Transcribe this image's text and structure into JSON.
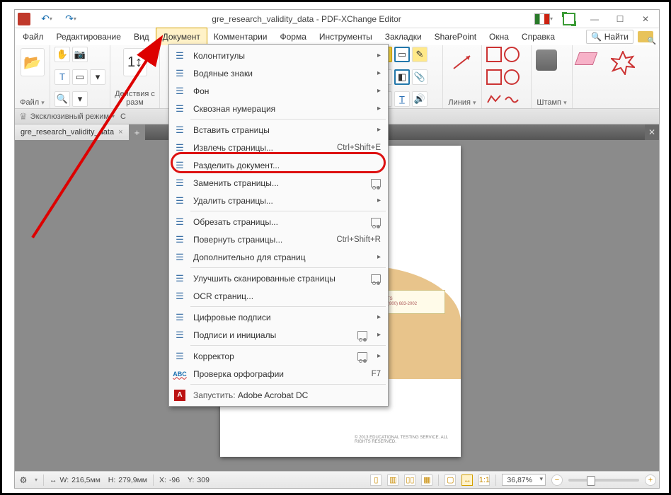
{
  "titlebar": {
    "doc_name": "gre_research_validity_data",
    "app_name": "PDF-XChange Editor",
    "full_title": "gre_research_validity_data - PDF-XChange Editor"
  },
  "menubar": {
    "items": [
      "Файл",
      "Редактирование",
      "Вид",
      "Документ",
      "Комментарии",
      "Форма",
      "Инструменты",
      "Закладки",
      "SharePoint",
      "Окна",
      "Справка"
    ],
    "active_index": 3,
    "find_label": "Найти"
  },
  "ribbon": {
    "group_file": "Файл",
    "group_actions": "Действия с\nразм",
    "group_content_label": "С",
    "group_line": "Линия",
    "group_stamp": "Штамп"
  },
  "modebar": {
    "exclusive_label": "Эксклюзивный режим"
  },
  "tabs": {
    "doc_tab": "gre_research_validity_data"
  },
  "dropdown": {
    "items": [
      {
        "label": "Колонтитулы",
        "submenu": true
      },
      {
        "label": "Водяные знаки",
        "submenu": true
      },
      {
        "label": "Фон",
        "submenu": true
      },
      {
        "label": "Сквозная нумерация",
        "submenu": true
      },
      {
        "sep": true
      },
      {
        "label": "Вставить страницы",
        "submenu": true
      },
      {
        "label": "Извлечь страницы...",
        "shortcut": "Ctrl+Shift+E",
        "highlighted": true
      },
      {
        "label": "Разделить документ..."
      },
      {
        "label": "Заменить страницы...",
        "cart": true
      },
      {
        "label": "Удалить страницы...",
        "submenu": true
      },
      {
        "sep": true
      },
      {
        "label": "Обрезать страницы...",
        "cart": true
      },
      {
        "label": "Повернуть страницы...",
        "shortcut": "Ctrl+Shift+R"
      },
      {
        "label": "Дополнительно для страниц",
        "submenu": true
      },
      {
        "sep": true
      },
      {
        "label": "Улучшить сканированные страницы",
        "cart": true
      },
      {
        "label": "OCR страниц..."
      },
      {
        "sep": true
      },
      {
        "label": "Цифровые подписи",
        "submenu": true
      },
      {
        "label": "Подписи и инициалы",
        "cart": true,
        "submenu": true
      },
      {
        "sep": true
      },
      {
        "label": "Корректор",
        "cart": true,
        "submenu": true
      },
      {
        "label": "Проверка орфографии",
        "shortcut": "F7",
        "abc": true
      },
      {
        "sep": true
      },
      {
        "label_prefix": "Запустить:",
        "label": "Adobe Acrobat DC",
        "adobe": true
      }
    ]
  },
  "page_preview": {
    "logo_line1": "ETS",
    "logo_line2": "1 (800) 683-2002",
    "footer": "© 2013 EDUCATIONAL TESTING SERVICE. ALL RIGHTS RESERVED."
  },
  "statusbar": {
    "w_label": "W:",
    "w_val": "216,5мм",
    "h_label": "H:",
    "h_val": "279,9мм",
    "x_label": "X:",
    "x_val": "-96",
    "y_label": "Y:",
    "y_val": "309",
    "zoom": "36,87%"
  }
}
